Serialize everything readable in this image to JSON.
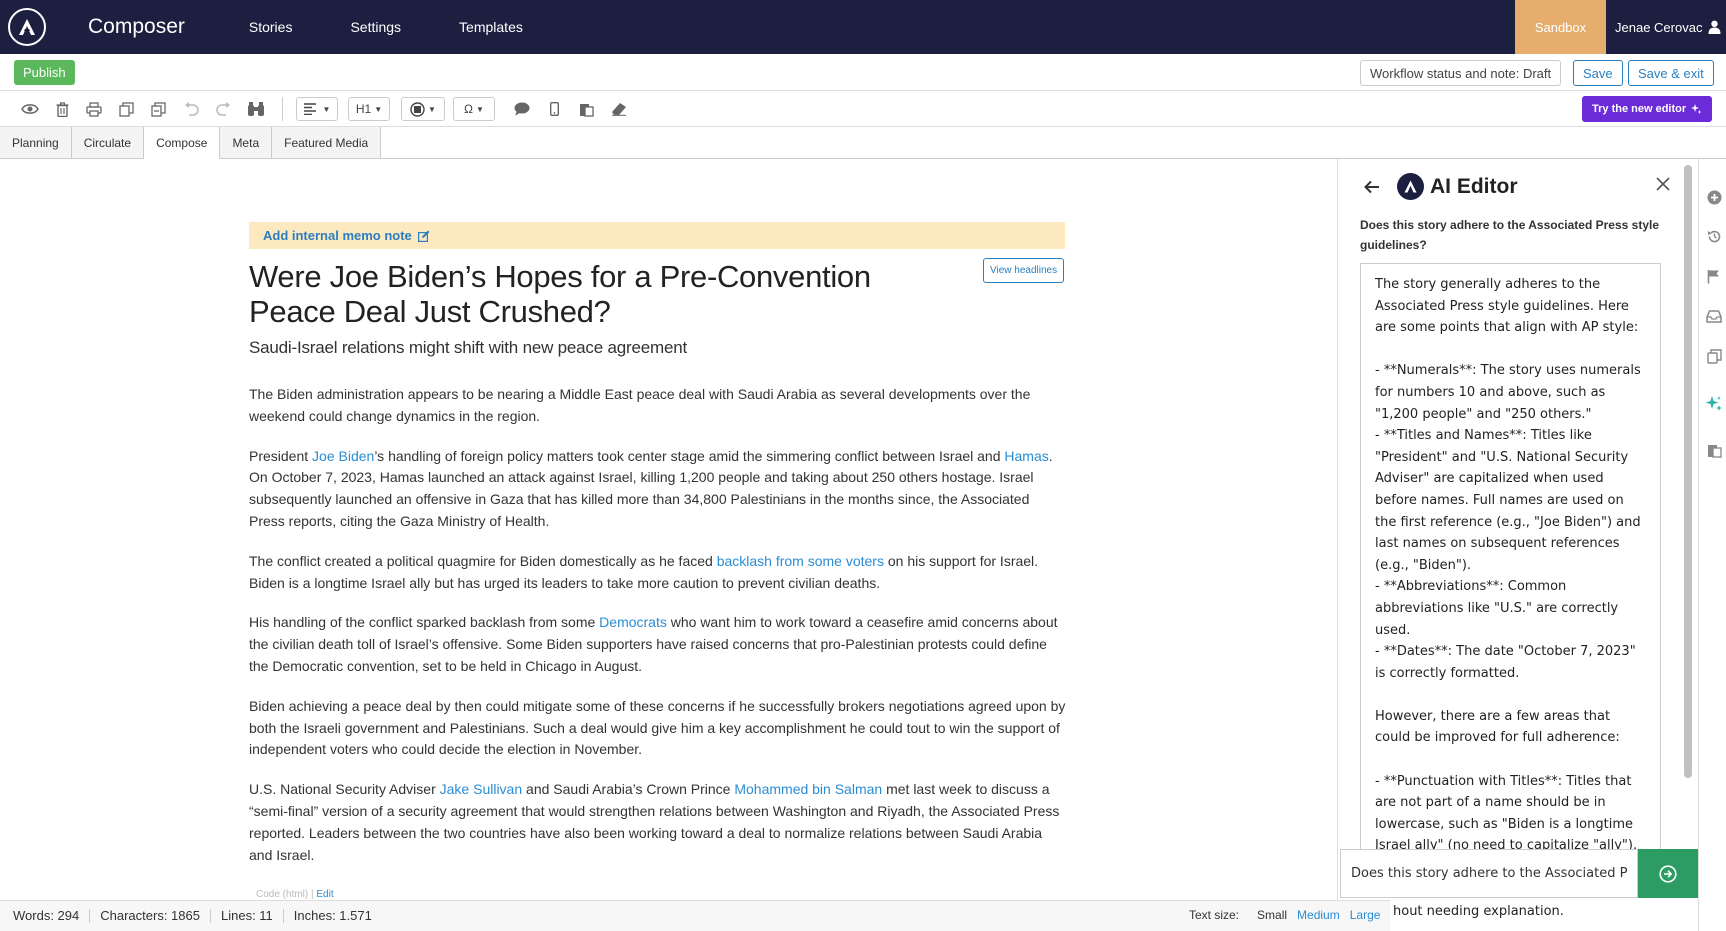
{
  "nav": {
    "app_title": "Composer",
    "links": [
      "Stories",
      "Settings",
      "Templates"
    ],
    "sandbox": "Sandbox",
    "user": "Jenae Cerovac"
  },
  "actions": {
    "publish": "Publish",
    "workflow": "Workflow status and note: Draft",
    "save": "Save",
    "save_exit": "Save & exit"
  },
  "toolbar": {
    "heading": "H1",
    "special_char": "Ω",
    "try_new_editor": "Try the new editor"
  },
  "tabs": [
    "Planning",
    "Circulate",
    "Compose",
    "Meta",
    "Featured Media"
  ],
  "active_tab": "Compose",
  "story": {
    "memo": "Add internal memo note",
    "view_headlines": "View headlines",
    "headline": "Were Joe Biden’s Hopes for a Pre-Convention Peace Deal Just Crushed?",
    "subhead": "Saudi-Israel relations might shift with new peace agreement",
    "p1": "The Biden administration appears to be nearing a Middle East peace deal with Saudi Arabia as several developments over the weekend could change dynamics in the region.",
    "p2": {
      "a": "President ",
      "link1": "Joe Biden",
      "b": "’s handling of foreign policy matters took center stage amid the simmering conflict between Israel and ",
      "link2": "Hamas",
      "c": ". On October 7, 2023, Hamas launched an attack against Israel, killing 1,200 people and taking about 250 others hostage. Israel subsequently launched an offensive in Gaza that has killed more than 34,800 Palestinians in the months since, the Associated Press reports, citing the Gaza Ministry of Health."
    },
    "p3": {
      "a": "The conflict created a political quagmire for Biden domestically as he faced ",
      "link1": "backlash from some voters",
      "b": " on his support for Israel. Biden is a longtime Israel ally but has urged its leaders to take more caution to prevent civilian deaths."
    },
    "p4": {
      "a": "His handling of the conflict sparked backlash from some ",
      "link1": "Democrats",
      "b": " who want him to work toward a ceasefire amid concerns about the civilian death toll of Israel’s offensive. Some Biden supporters have raised concerns that pro-Palestinian protests could define the Democratic convention, set to be held in Chicago in August."
    },
    "p5": "Biden achieving a peace deal by then could mitigate some of these concerns if he successfully brokers negotiations agreed upon by both the Israeli government and Palestinians. Such a deal would give him a key accomplishment he could tout to win the support of independent voters who could decide the election in November.",
    "p6": {
      "a": "U.S. National Security Adviser ",
      "link1": "Jake Sullivan",
      "b": " and Saudi Arabia’s Crown Prince ",
      "link2": "Mohammed bin Salman",
      "c": " met last week to discuss a “semi-final” version of a security agreement that would strengthen relations between Washington and Riyadh, the Associated Press reported. Leaders between the two countries have also been working toward a deal to normalize relations between Saudi Arabia and Israel."
    },
    "code_label": "Code (html) | ",
    "code_edit": "Edit"
  },
  "ai": {
    "title": "AI Editor",
    "question": "Does this story adhere to the Associated Press style guidelines?",
    "response": "The story generally adheres to the Associated Press style guidelines. Here are some points that align with AP style:\n\n- **Numerals**: The story uses numerals for numbers 10 and above, such as \"1,200 people\" and \"250 others.\"\n- **Titles and Names**: Titles like \"President\" and \"U.S. National Security Adviser\" are capitalized when used before names. Full names are used on the first reference (e.g., \"Joe Biden\") and last names on subsequent references (e.g., \"Biden\").\n- **Abbreviations**: Common abbreviations like \"U.S.\" are correctly used.\n- **Dates**: The date \"October 7, 2023\" is correctly formatted.\n\nHowever, there are a few areas that could be improved for full adherence:\n\n- **Punctuation with Titles**: Titles that are not part of a name should be in lowercase, such as \"Biden is a longtime Israel ally\" (no need to capitalize \"ally\").",
    "input_value": "Does this story adhere to the Associated P",
    "tail": "hout needing explanation."
  },
  "status": {
    "words": "Words: 294",
    "characters": "Characters: 1865",
    "lines": "Lines: 11",
    "inches": "Inches: 1.571",
    "text_size_label": "Text size:",
    "small": "Small",
    "medium": "Medium",
    "large": "Large"
  },
  "colors": {
    "nav_bg": "#1c1f3f",
    "sandbox": "#e6ad6c",
    "publish": "#5cb85c",
    "link": "#2a8dd4",
    "memo_bg": "#fde9c0",
    "try_editor": "#6b2bd9",
    "ai_send": "#2d9c64"
  }
}
